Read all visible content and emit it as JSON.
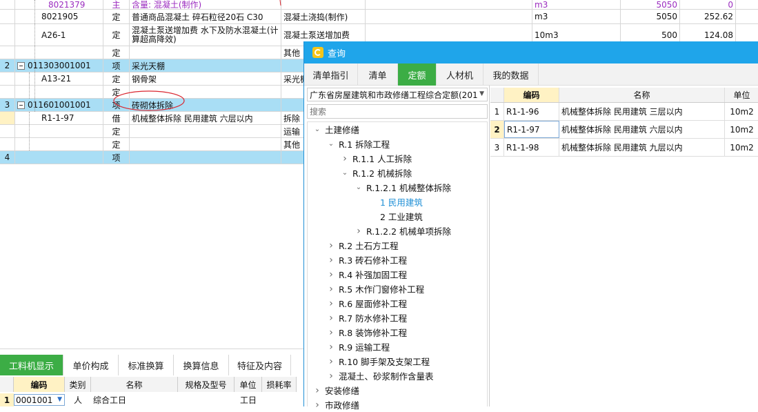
{
  "main_grid": {
    "rows": [
      {
        "code": "8021379",
        "type": "主",
        "name": "含量: 混凝土(制作)",
        "feature": "",
        "unit": "m3",
        "qty": "5050",
        "price": "0",
        "style": "purple"
      },
      {
        "code": "8021905",
        "type": "定",
        "name": "普通商品混凝土 碎石粒径20石 C30",
        "feature": "混凝土浇捣(制作)",
        "unit": "m3",
        "qty": "5050",
        "price": "252.62"
      },
      {
        "code": "A26-1",
        "type": "定",
        "name": "混凝土泵送增加费 水下及防水混凝土(计算超高降效)",
        "feature": "混凝土泵送增加费",
        "unit": "10m3",
        "qty": "500",
        "price": "124.08"
      },
      {
        "code": "",
        "type": "定",
        "name": "",
        "feature": "其他"
      },
      {
        "index": "2",
        "code": "011303001001",
        "type": "项",
        "name": "采光天棚",
        "feature": ""
      },
      {
        "code": "A13-21",
        "type": "定",
        "name": "钢骨架",
        "feature": "采光棚"
      },
      {
        "code": "",
        "type": "定",
        "name": "",
        "feature": ""
      },
      {
        "index": "3",
        "code": "011601001001",
        "type": "项",
        "name": "砖砌体拆除",
        "feature": ""
      },
      {
        "code": "R1-1-97",
        "type": "借",
        "name": "机械整体拆除 民用建筑 六层以内",
        "feature": "拆除"
      },
      {
        "code": "",
        "type": "定",
        "name": "",
        "feature": "运输"
      },
      {
        "code": "",
        "type": "定",
        "name": "",
        "feature": "其他"
      },
      {
        "index": "4",
        "code": "",
        "type": "项",
        "name": "",
        "feature": ""
      }
    ]
  },
  "bottom_panel": {
    "tabs": [
      "工料机显示",
      "单价构成",
      "标准换算",
      "换算信息",
      "特征及内容"
    ],
    "columns": [
      "编码",
      "类别",
      "名称",
      "规格及型号",
      "单位",
      "损耗率"
    ],
    "row": {
      "index": "1",
      "code": "0001001",
      "type": "人",
      "name": "综合工日",
      "unit": "工日"
    }
  },
  "dialog": {
    "title": "查询",
    "tabs": [
      "清单指引",
      "清单",
      "定额",
      "人材机",
      "我的数据"
    ],
    "active_tab": "定额",
    "library_select": "广东省房屋建筑和市政修缮工程综合定额(201",
    "search_placeholder": "搜索",
    "tree": [
      {
        "label": "土建修缮",
        "level": 0,
        "arrow": "down"
      },
      {
        "label": "R.1 拆除工程",
        "level": 1,
        "arrow": "down"
      },
      {
        "label": "R.1.1 人工拆除",
        "level": 2,
        "arrow": "right"
      },
      {
        "label": "R.1.2 机械拆除",
        "level": 2,
        "arrow": "down"
      },
      {
        "label": "R.1.2.1 机械整体拆除",
        "level": 3,
        "arrow": "down"
      },
      {
        "label": "1 民用建筑",
        "level": 4,
        "arrow": "",
        "selected": true
      },
      {
        "label": "2 工业建筑",
        "level": 4,
        "arrow": ""
      },
      {
        "label": "R.1.2.2 机械单项拆除",
        "level": 3,
        "arrow": "right"
      },
      {
        "label": "R.2 土石方工程",
        "level": 1,
        "arrow": "right"
      },
      {
        "label": "R.3 砖石修补工程",
        "level": 1,
        "arrow": "right"
      },
      {
        "label": "R.4 补强加固工程",
        "level": 1,
        "arrow": "right"
      },
      {
        "label": "R.5 木作门窗修补工程",
        "level": 1,
        "arrow": "right"
      },
      {
        "label": "R.6 屋面修补工程",
        "level": 1,
        "arrow": "right"
      },
      {
        "label": "R.7 防水修补工程",
        "level": 1,
        "arrow": "right"
      },
      {
        "label": "R.8 装饰修补工程",
        "level": 1,
        "arrow": "right"
      },
      {
        "label": "R.9 运输工程",
        "level": 1,
        "arrow": "right"
      },
      {
        "label": "R.10 脚手架及支架工程",
        "level": 1,
        "arrow": "right"
      },
      {
        "label": "混凝土、砂浆制作含量表",
        "level": 1,
        "arrow": "right"
      },
      {
        "label": "安装修缮",
        "level": 0,
        "arrow": "right"
      },
      {
        "label": "市政修缮",
        "level": 0,
        "arrow": "right"
      }
    ],
    "result_columns": [
      "编码",
      "名称",
      "单位"
    ],
    "results": [
      {
        "index": "1",
        "code": "R1-1-96",
        "name": "机械整体拆除 民用建筑 三层以内",
        "unit": "10m2"
      },
      {
        "index": "2",
        "code": "R1-1-97",
        "name": "机械整体拆除 民用建筑 六层以内",
        "unit": "10m2"
      },
      {
        "index": "3",
        "code": "R1-1-98",
        "name": "机械整体拆除 民用建筑 九层以内",
        "unit": "10m2"
      }
    ]
  },
  "colors": {
    "accent_green": "#3cad45",
    "titlebar_blue": "#1fa5ea",
    "row_highlight": "#a9def5"
  }
}
